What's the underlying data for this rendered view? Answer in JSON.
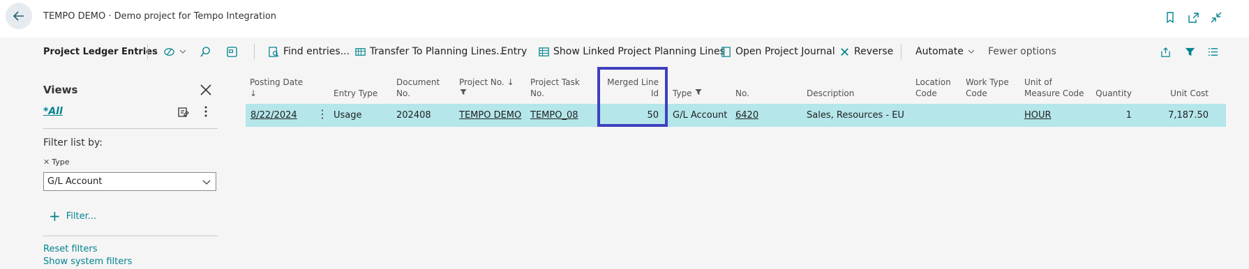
{
  "header": {
    "title": "TEMPO DEMO · Demo project for Tempo Integration"
  },
  "actionbar": {
    "title": "Project Ledger Entries",
    "find_entries": "Find entries...",
    "transfer": "Transfer To Planning Lines...",
    "entry": "Entry",
    "show_linked": "Show Linked Project Planning Lines",
    "open_journal": "Open Project Journal",
    "reverse": "Reverse",
    "automate": "Automate",
    "fewer_options": "Fewer options"
  },
  "views": {
    "title": "Views",
    "current_view": "*All",
    "filter_list_by": "Filter list by:",
    "filter_field": "Type",
    "filter_value": "G/L Account",
    "add_filter": "Filter...",
    "reset_filters": "Reset filters",
    "show_system_filters": "Show system filters"
  },
  "grid": {
    "columns": {
      "posting_date": "Posting Date",
      "entry_type": "Entry Type",
      "document_no_1": "Document",
      "document_no_2": "No.",
      "project_no": "Project No.",
      "project_task_1": "Project Task",
      "project_task_2": "No.",
      "merged_line_1": "Merged Line",
      "merged_line_2": "Id",
      "type": "Type",
      "no": "No.",
      "description": "Description",
      "location_1": "Location",
      "location_2": "Code",
      "work_type_1": "Work Type",
      "work_type_2": "Code",
      "uom_1": "Unit of",
      "uom_2": "Measure Code",
      "quantity": "Quantity",
      "unit_cost": "Unit Cost"
    },
    "rows": [
      {
        "posting_date": "8/22/2024",
        "entry_type": "Usage",
        "document_no": "202408",
        "project_no": "TEMPO DEMO",
        "project_task_no": "TEMPO_08",
        "merged_line_id": "50",
        "type": "G/L Account",
        "no": "6420",
        "description": "Sales, Resources - EU",
        "location_code": "",
        "work_type_code": "",
        "uom_code": "HOUR",
        "quantity": "1",
        "unit_cost": "7,187.50"
      }
    ]
  },
  "colors": {
    "accent": "#00838f",
    "row_selected": "#b4e6ea",
    "highlight_border": "#3f3fbf"
  }
}
